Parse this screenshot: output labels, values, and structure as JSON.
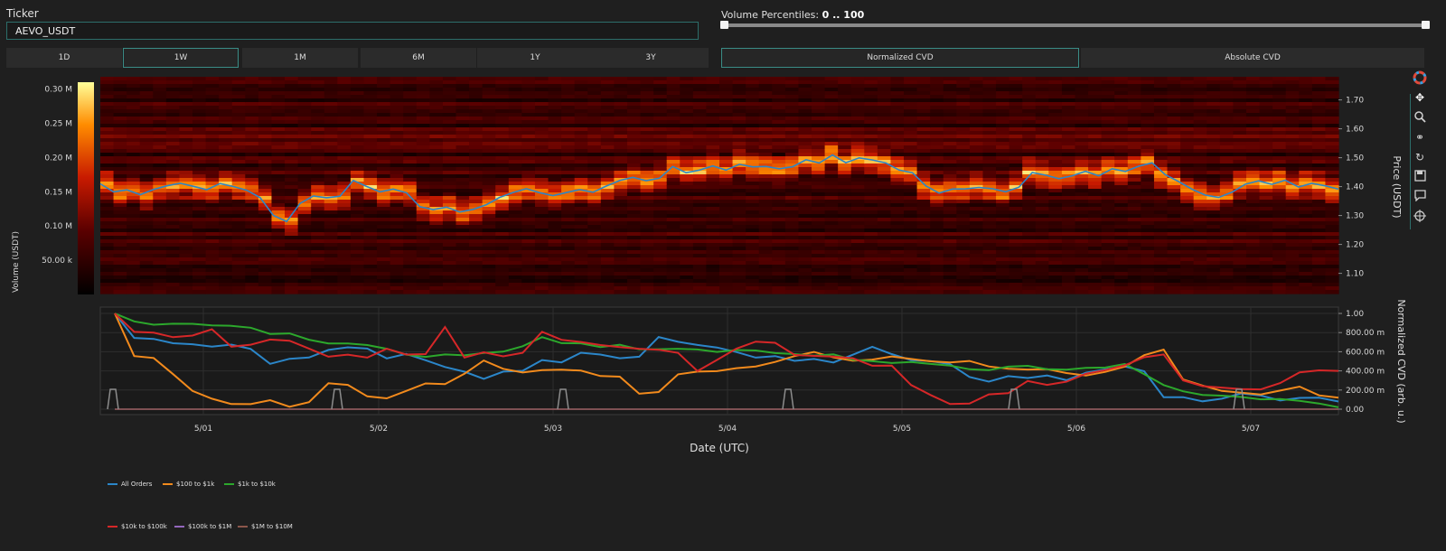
{
  "ticker": {
    "label": "Ticker",
    "value": "AEVO_USDT"
  },
  "ranges": [
    "1D",
    "1W",
    "1M",
    "6M",
    "1Y",
    "3Y"
  ],
  "active_range": "1W",
  "volume_percentiles": {
    "label": "Volume Percentiles:",
    "value": "0 .. 100",
    "min": 0,
    "max": 100
  },
  "cvd_modes": [
    "Normalized CVD",
    "Absolute CVD"
  ],
  "active_cvd_mode": "Normalized CVD",
  "toolbar": [
    "palette-icon",
    "pan-icon",
    "zoom-icon",
    "link-icon",
    "reset-icon",
    "save-icon",
    "comment-icon",
    "crosshair-icon"
  ],
  "colors": {
    "accent": "#2c6e6a",
    "blue": "#2b86c9",
    "orange": "#f28a1c",
    "green": "#2ca82c",
    "red": "#d62728",
    "purple": "#9467bd",
    "brown": "#8c564b"
  },
  "chart_data": [
    {
      "type": "heatmap",
      "xlabel": "",
      "ylabel": "Price (USDT)",
      "ylim": [
        1.03,
        1.78
      ],
      "y_ticks": [
        "1.10",
        "1.20",
        "1.30",
        "1.40",
        "1.50",
        "1.60",
        "1.70"
      ],
      "colorbar": {
        "label": "Volume (USDT)",
        "ticks": [
          "50.00 k",
          "0.10 M",
          "0.15 M",
          "0.20 M",
          "0.25 M",
          "0.30 M"
        ],
        "range": [
          0,
          0.31
        ]
      },
      "price_line_color": "#2b86c9",
      "price": [
        1.41,
        1.38,
        1.39,
        1.37,
        1.39,
        1.4,
        1.41,
        1.4,
        1.39,
        1.41,
        1.4,
        1.39,
        1.36,
        1.3,
        1.28,
        1.34,
        1.37,
        1.36,
        1.37,
        1.42,
        1.4,
        1.38,
        1.39,
        1.38,
        1.33,
        1.32,
        1.33,
        1.31,
        1.32,
        1.34,
        1.36,
        1.38,
        1.39,
        1.38,
        1.37,
        1.38,
        1.39,
        1.38,
        1.4,
        1.42,
        1.43,
        1.42,
        1.43,
        1.47,
        1.45,
        1.46,
        1.47,
        1.46,
        1.48,
        1.47,
        1.47,
        1.46,
        1.47,
        1.49,
        1.48,
        1.51,
        1.48,
        1.5,
        1.49,
        1.48,
        1.46,
        1.45,
        1.4,
        1.38,
        1.39,
        1.39,
        1.4,
        1.39,
        1.38,
        1.4,
        1.45,
        1.44,
        1.43,
        1.44,
        1.45,
        1.44,
        1.46,
        1.45,
        1.47,
        1.48,
        1.44,
        1.42,
        1.39,
        1.37,
        1.36,
        1.38,
        1.41,
        1.42,
        1.41,
        1.42,
        1.4,
        1.41,
        1.4,
        1.39
      ]
    },
    {
      "type": "line",
      "xlabel": "Date (UTC)",
      "ylabel": "Normalized CVD (arb. u.)",
      "x_ticks": [
        "5/01",
        "5/02",
        "5/03",
        "5/04",
        "5/05",
        "5/06",
        "5/07"
      ],
      "y_ticks": [
        "0.00",
        "200.00 m",
        "400.00 m",
        "600.00 m",
        "800.00 m",
        "1.00"
      ],
      "ylim": [
        0,
        1.0
      ],
      "series": [
        {
          "name": "All Orders",
          "color": "#2b86c9",
          "values": [
            1.0,
            0.74,
            0.72,
            0.7,
            0.68,
            0.66,
            0.66,
            0.63,
            0.48,
            0.52,
            0.55,
            0.62,
            0.64,
            0.62,
            0.54,
            0.58,
            0.52,
            0.43,
            0.4,
            0.32,
            0.38,
            0.4,
            0.5,
            0.48,
            0.58,
            0.58,
            0.52,
            0.55,
            0.75,
            0.7,
            0.66,
            0.64,
            0.6,
            0.54,
            0.55,
            0.5,
            0.52,
            0.5,
            0.56,
            0.64,
            0.58,
            0.52,
            0.5,
            0.46,
            0.34,
            0.3,
            0.36,
            0.32,
            0.34,
            0.31,
            0.38,
            0.42,
            0.46,
            0.4,
            0.14,
            0.12,
            0.08,
            0.12,
            0.16,
            0.14,
            0.1,
            0.12,
            0.11,
            0.08
          ]
        },
        {
          "name": "$100 to $1k",
          "color": "#f28a1c",
          "values": [
            1.0,
            0.55,
            0.54,
            0.36,
            0.18,
            0.1,
            0.05,
            0.06,
            0.1,
            0.04,
            0.08,
            0.28,
            0.26,
            0.14,
            0.1,
            0.18,
            0.26,
            0.25,
            0.38,
            0.52,
            0.42,
            0.38,
            0.4,
            0.42,
            0.4,
            0.36,
            0.34,
            0.16,
            0.18,
            0.36,
            0.38,
            0.4,
            0.44,
            0.46,
            0.5,
            0.56,
            0.6,
            0.54,
            0.5,
            0.52,
            0.55,
            0.52,
            0.5,
            0.48,
            0.5,
            0.46,
            0.42,
            0.4,
            0.42,
            0.38,
            0.36,
            0.4,
            0.44,
            0.56,
            0.62,
            0.3,
            0.24,
            0.2,
            0.18,
            0.14,
            0.2,
            0.24,
            0.14,
            0.12
          ]
        },
        {
          "name": "$1k to $10k",
          "color": "#2ca82c",
          "values": [
            1.0,
            0.92,
            0.88,
            0.9,
            0.88,
            0.88,
            0.88,
            0.86,
            0.8,
            0.78,
            0.72,
            0.7,
            0.68,
            0.66,
            0.62,
            0.58,
            0.56,
            0.56,
            0.56,
            0.58,
            0.6,
            0.66,
            0.76,
            0.7,
            0.7,
            0.66,
            0.68,
            0.64,
            0.62,
            0.64,
            0.62,
            0.6,
            0.62,
            0.62,
            0.58,
            0.58,
            0.56,
            0.56,
            0.52,
            0.5,
            0.48,
            0.48,
            0.46,
            0.44,
            0.42,
            0.42,
            0.44,
            0.46,
            0.42,
            0.4,
            0.42,
            0.44,
            0.48,
            0.36,
            0.26,
            0.2,
            0.16,
            0.14,
            0.12,
            0.1,
            0.1,
            0.08,
            0.06,
            0.02
          ]
        },
        {
          "name": "$10k to $100k",
          "color": "#d62728",
          "values": [
            1.0,
            0.82,
            0.8,
            0.76,
            0.78,
            0.84,
            0.66,
            0.68,
            0.72,
            0.7,
            0.62,
            0.56,
            0.56,
            0.54,
            0.62,
            0.58,
            0.58,
            0.86,
            0.54,
            0.58,
            0.56,
            0.6,
            0.8,
            0.72,
            0.7,
            0.68,
            0.66,
            0.64,
            0.62,
            0.6,
            0.4,
            0.52,
            0.62,
            0.7,
            0.68,
            0.58,
            0.56,
            0.54,
            0.52,
            0.44,
            0.46,
            0.24,
            0.14,
            0.04,
            0.06,
            0.16,
            0.18,
            0.28,
            0.24,
            0.3,
            0.36,
            0.42,
            0.46,
            0.54,
            0.58,
            0.3,
            0.24,
            0.22,
            0.2,
            0.22,
            0.26,
            0.38,
            0.4,
            0.4
          ]
        },
        {
          "name": "$100k to $1M",
          "color": "#9467bd",
          "values": [
            0,
            0,
            0,
            0,
            0,
            0,
            0,
            0,
            0,
            0,
            0,
            0,
            0,
            0,
            0,
            0,
            0,
            0,
            0,
            0,
            0,
            0,
            0,
            0,
            0,
            0,
            0,
            0,
            0,
            0,
            0,
            0,
            0,
            0,
            0,
            0,
            0,
            0,
            0,
            0,
            0,
            0,
            0,
            0,
            0,
            0,
            0,
            0,
            0,
            0,
            0,
            0,
            0,
            0,
            0,
            0,
            0,
            0,
            0,
            0,
            0,
            0,
            0,
            0
          ]
        },
        {
          "name": "$1M to $10M",
          "color": "#8c564b",
          "values": [
            0,
            0,
            0,
            0,
            0,
            0,
            0,
            0,
            0,
            0,
            0,
            0,
            0,
            0,
            0,
            0,
            0,
            0,
            0,
            0,
            0,
            0,
            0,
            0,
            0,
            0,
            0,
            0,
            0,
            0,
            0,
            0,
            0,
            0,
            0,
            0,
            0,
            0,
            0,
            0,
            0,
            0,
            0,
            0,
            0,
            0,
            0,
            0,
            0,
            0,
            0,
            0,
            0,
            0,
            0,
            0,
            0,
            0,
            0,
            0,
            0,
            0,
            0,
            0
          ]
        }
      ]
    }
  ]
}
